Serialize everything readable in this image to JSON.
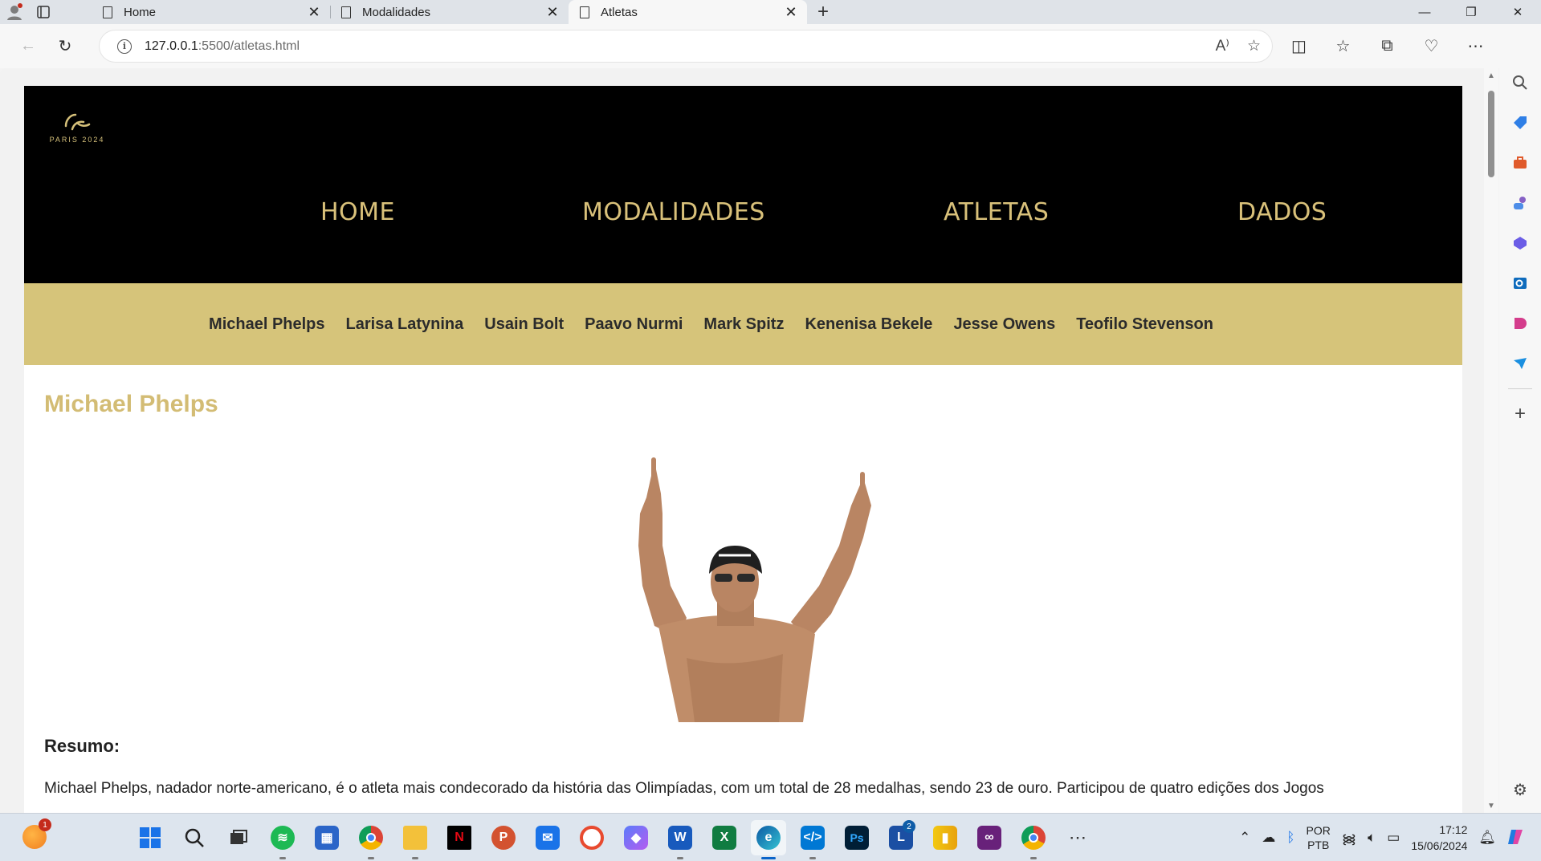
{
  "browser": {
    "tabs": [
      {
        "title": "Home",
        "active": false
      },
      {
        "title": "Modalidades",
        "active": false
      },
      {
        "title": "Atletas",
        "active": true
      }
    ],
    "url_host": "127.0.0.1",
    "url_rest": ":5500/atletas.html"
  },
  "site": {
    "logo_text": "PARIS 2024",
    "nav": [
      "HOME",
      "MODALIDADES",
      "ATLETAS",
      "DADOS"
    ],
    "athletes": [
      "Michael Phelps",
      "Larisa Latynina",
      "Usain Bolt",
      "Paavo Nurmi",
      "Mark Spitz",
      "Kenenisa Bekele",
      "Jesse Owens",
      "Teofilo Stevenson"
    ],
    "athlete_name": "Michael Phelps",
    "summary_title": "Resumo:",
    "summary_text": "Michael Phelps, nadador norte-americano, é o atleta mais condecorado da história das Olimpíadas, com um total de 28 medalhas, sendo 23 de ouro. Participou de quatro edições dos Jogos"
  },
  "taskbar": {
    "weather_badge": "1",
    "lang_top": "POR",
    "lang_bottom": "PTB",
    "time": "17:12",
    "date": "15/06/2024",
    "teams_badge": "2"
  },
  "colors": {
    "gold": "#d9c17a",
    "athlete_bar": "#d6c47a",
    "hero_bg": "#000000"
  }
}
